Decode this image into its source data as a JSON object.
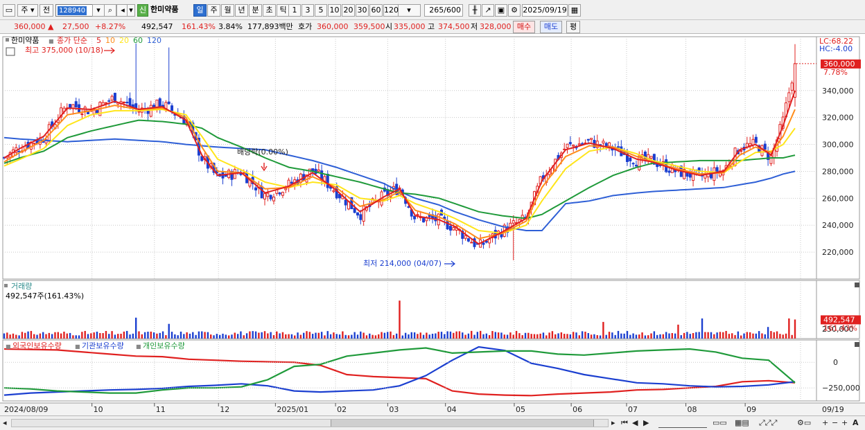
{
  "toolbar": {
    "period_main": "주",
    "prev_label": "전",
    "stock_code": "128940",
    "sin_badge": "신",
    "stock_name": "한미약품",
    "periods": [
      "일",
      "주",
      "월",
      "년",
      "분",
      "초",
      "틱"
    ],
    "active_period": "일",
    "intervals": [
      "1",
      "3",
      "5",
      "10",
      "20",
      "30",
      "60",
      "120"
    ],
    "count": "265",
    "count_max": "/600",
    "date": "2025/09/19"
  },
  "quote": {
    "price": "360,000",
    "arrow": "▲",
    "change": "27,500",
    "change_pct": "+8.27%",
    "volume": "492,547",
    "volume_ratio": "161.43%",
    "turnover": "3.84%",
    "amount": "177,893백만",
    "ask_label": "호가",
    "ask1": "360,000",
    "ask2": "359,500",
    "open_label": "시",
    "open": "335,000",
    "high_label": "고",
    "high": "374,500",
    "low_label": "저",
    "low": "328,000",
    "buy_label": "매수",
    "sell_label": "매도",
    "eval_label": "평"
  },
  "legend": {
    "name": "한미약품",
    "ma_label": "종가 단순",
    "ma_periods": [
      "5",
      "10",
      "20",
      "60",
      "120"
    ],
    "lc": "LC:68.22",
    "hc": "HC:-4.00"
  },
  "annotations": {
    "high": "최고 375,000 (10/18)",
    "low": "최저 214,000 (04/07)",
    "dividend": "배당락(0.00%)",
    "price_tag": "360,000",
    "pct_tag": "7.78%"
  },
  "volume_panel": {
    "title": "거래량",
    "value": "492,547주(161.43%)",
    "tag": "492,547",
    "tag_pct": "161.43%"
  },
  "holding_panel": {
    "foreign": "외국인보유수량",
    "institution": "기관보유수량",
    "individual": "개인보유수량"
  },
  "colors": {
    "up": "#e0201f",
    "down": "#1b3fd0",
    "ma5": "#e0201f",
    "ma10": "#ff8c1a",
    "ma20": "#ffe51a",
    "ma60": "#1f9a3a",
    "ma120": "#2e5fd6"
  },
  "chart_data": [
    {
      "type": "line",
      "title": "",
      "y_ticks": [
        220000,
        240000,
        260000,
        280000,
        300000,
        320000,
        340000
      ],
      "ylim": [
        200000,
        380000
      ],
      "x_ticks": [
        "2024/08/09",
        "10",
        "11",
        "12",
        "2025/01",
        "02",
        "03",
        "04",
        "05",
        "06",
        "07",
        "08",
        "09",
        "09/19"
      ],
      "x_ticks_display": [
        "2024/08/09",
        "10",
        "11",
        "12",
        "2025/01",
        "02",
        "03",
        "04",
        "05",
        "06",
        "07",
        "08",
        "09",
        "09/19"
      ],
      "legend": "top-left",
      "close_series": {
        "name": "",
        "t": [
          0,
          0.02,
          0.05,
          0.08,
          0.11,
          0.14,
          0.17,
          0.2,
          0.23,
          0.25,
          0.27,
          0.3,
          0.33,
          0.36,
          0.39,
          0.42,
          0.45,
          0.48,
          0.5,
          0.52,
          0.55,
          0.57,
          0.6,
          0.63,
          0.66,
          0.68,
          0.71,
          0.74,
          0.77,
          0.8,
          0.82,
          0.85,
          0.88,
          0.91,
          0.93,
          0.95,
          0.97,
          0.985,
          1.0
        ],
        "values": [
          290000,
          298000,
          305000,
          330000,
          325000,
          335000,
          325000,
          330000,
          318000,
          290000,
          275000,
          280000,
          262000,
          270000,
          281000,
          265000,
          248000,
          262000,
          268000,
          245000,
          244000,
          238000,
          224000,
          236000,
          245000,
          275000,
          298000,
          302000,
          297000,
          288000,
          288000,
          280000,
          276000,
          281000,
          298000,
          300000,
          290000,
          318000,
          360000
        ]
      },
      "series": [
        {
          "name": "5",
          "values": [
            290000,
            297000,
            306000,
            327000,
            326000,
            332000,
            326000,
            328000,
            318000,
            292000,
            277000,
            279000,
            264000,
            269000,
            279000,
            266000,
            250000,
            261000,
            267000,
            247000,
            244000,
            239000,
            226000,
            235000,
            245000,
            273000,
            296000,
            301000,
            297000,
            289000,
            287000,
            281000,
            277000,
            280000,
            296000,
            300000,
            292000,
            314000,
            340000
          ]
        },
        {
          "name": "10",
          "values": [
            287000,
            294000,
            303000,
            322000,
            325000,
            329000,
            326000,
            327000,
            320000,
            298000,
            280000,
            279000,
            267000,
            268000,
            276000,
            268000,
            254000,
            259000,
            265000,
            251000,
            246000,
            241000,
            230000,
            234000,
            243000,
            268000,
            291000,
            299000,
            298000,
            291000,
            287000,
            282000,
            278000,
            279000,
            292000,
            298000,
            294000,
            306000,
            326000
          ]
        },
        {
          "name": "20",
          "values": [
            284000,
            289000,
            297000,
            314000,
            322000,
            325000,
            325000,
            326000,
            322000,
            306000,
            289000,
            281000,
            272000,
            268000,
            272000,
            270000,
            260000,
            258000,
            262000,
            256000,
            250000,
            245000,
            236000,
            234000,
            240000,
            258000,
            282000,
            295000,
            298000,
            293000,
            288000,
            284000,
            280000,
            279000,
            287000,
            294000,
            295000,
            300000,
            312000
          ]
        },
        {
          "name": "60",
          "values": [
            286000,
            290000,
            295000,
            305000,
            310000,
            314000,
            318000,
            317000,
            315000,
            312000,
            305000,
            298000,
            290000,
            283000,
            280000,
            276000,
            272000,
            267000,
            264000,
            263000,
            260000,
            256000,
            250000,
            247000,
            245000,
            248000,
            258000,
            268000,
            277000,
            283000,
            286000,
            287000,
            288000,
            288000,
            288000,
            289000,
            290000,
            290000,
            292000
          ]
        },
        {
          "name": "120",
          "values": [
            305000,
            304000,
            303000,
            302000,
            303000,
            304000,
            303000,
            302000,
            300000,
            299000,
            298000,
            297000,
            296000,
            292000,
            288000,
            283000,
            277000,
            271000,
            265000,
            260000,
            255000,
            250000,
            244000,
            239000,
            236000,
            236000,
            256000,
            258000,
            262000,
            264000,
            265000,
            266000,
            267000,
            268000,
            270000,
            272000,
            275000,
            278000,
            280000
          ]
        }
      ]
    },
    {
      "type": "bar",
      "title": "거래량",
      "y_ticks": [
        250000
      ],
      "last_value": 492547
    },
    {
      "type": "line",
      "title": "",
      "y_ticks": [
        0,
        -250000
      ],
      "series": [
        {
          "name": "외국인보유수량",
          "values": [
            130000,
            125000,
            120000,
            100000,
            80000,
            60000,
            55000,
            30000,
            20000,
            10000,
            5000,
            0,
            -30000,
            -120000,
            -140000,
            -150000,
            -160000,
            -280000,
            -310000,
            -320000,
            -325000,
            -310000,
            -300000,
            -290000,
            -270000,
            -265000,
            -250000,
            -235000,
            -190000,
            -180000,
            -200000
          ]
        },
        {
          "name": "기관보유수량",
          "values": [
            -320000,
            -300000,
            -290000,
            -280000,
            -270000,
            -265000,
            -255000,
            -235000,
            -225000,
            -210000,
            -230000,
            -280000,
            -290000,
            -280000,
            -270000,
            -230000,
            -130000,
            20000,
            150000,
            115000,
            -10000,
            -60000,
            -120000,
            -160000,
            -200000,
            -210000,
            -230000,
            -240000,
            -235000,
            -220000,
            -190000
          ]
        },
        {
          "name": "개인보유수량",
          "values": [
            -250000,
            -260000,
            -280000,
            -290000,
            -300000,
            -300000,
            -270000,
            -250000,
            -250000,
            -240000,
            -170000,
            -40000,
            -20000,
            60000,
            90000,
            120000,
            140000,
            90000,
            100000,
            110000,
            110000,
            80000,
            70000,
            90000,
            110000,
            120000,
            130000,
            100000,
            40000,
            20000,
            -200000
          ]
        }
      ]
    }
  ]
}
